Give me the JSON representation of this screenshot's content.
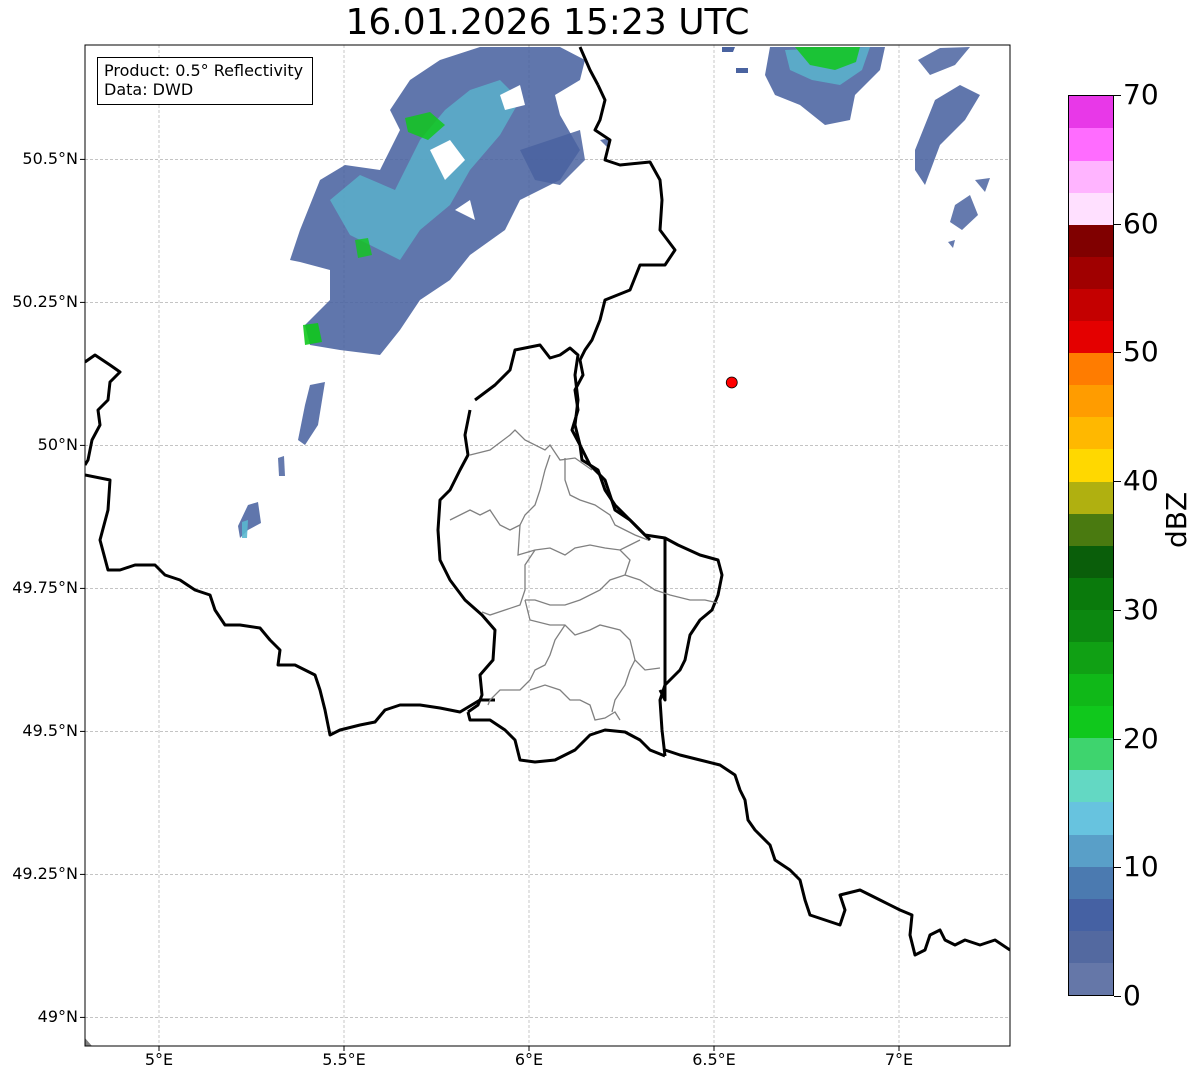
{
  "title": "16.01.2026 15:23 UTC",
  "info": {
    "product": "Product: 0.5° Reflectivity",
    "source": "Data: DWD"
  },
  "lat_ticks": [
    {
      "label": "50.5°N",
      "value": 50.5
    },
    {
      "label": "50.25°N",
      "value": 50.25
    },
    {
      "label": "50°N",
      "value": 50.0
    },
    {
      "label": "49.75°N",
      "value": 49.75
    },
    {
      "label": "49.5°N",
      "value": 49.5
    },
    {
      "label": "49.25°N",
      "value": 49.25
    },
    {
      "label": "49°N",
      "value": 49.0
    }
  ],
  "lon_ticks": [
    {
      "label": "5°E",
      "value": 5.0
    },
    {
      "label": "5.5°E",
      "value": 5.5
    },
    {
      "label": "6°E",
      "value": 6.0
    },
    {
      "label": "6.5°E",
      "value": 6.5
    },
    {
      "label": "7°E",
      "value": 7.0
    }
  ],
  "map_extent": {
    "lon_min": 4.8,
    "lon_max": 7.3,
    "lat_min": 48.95,
    "lat_max": 50.7
  },
  "radar_site": {
    "lon": 6.548,
    "lat": 50.11,
    "color": "#ff0000"
  },
  "colorbar": {
    "unit": "dBZ",
    "range": [
      0,
      70
    ],
    "ticks": [
      "0",
      "10",
      "20",
      "30",
      "40",
      "50",
      "60",
      "70"
    ],
    "colors": [
      "#6577a8",
      "#5369a0",
      "#4561a3",
      "#4b7ab0",
      "#599fc8",
      "#67c3df",
      "#63d8c3",
      "#3ed46e",
      "#10c81c",
      "#10b818",
      "#10a014",
      "#0c8810",
      "#0a7a0c",
      "#0a5e0a",
      "#4a7a10",
      "#b0b010",
      "#ffd800",
      "#ffb800",
      "#ff9c00",
      "#ff7c00",
      "#e40000",
      "#c40000",
      "#a00000",
      "#800000",
      "#ffe0ff",
      "#ffb4ff",
      "#ff6cff",
      "#e838e8"
    ]
  },
  "colors": {
    "border_country": "#000000",
    "border_canton": "#808080",
    "gridline": "#b0b0b0",
    "echo_light": "#4a63a0",
    "echo_mid": "#5ab8cf",
    "echo_strong": "#10c81c"
  }
}
